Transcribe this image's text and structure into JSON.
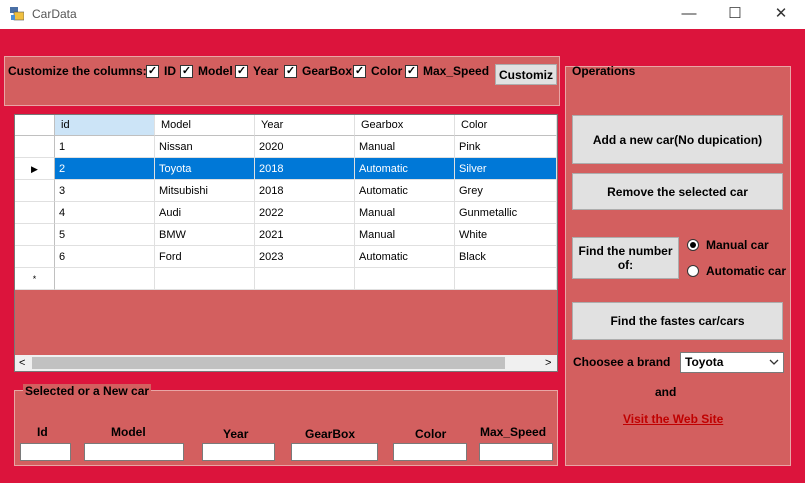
{
  "window": {
    "title": "CarData",
    "minimize": "—",
    "maximize": "☐",
    "close": "✕"
  },
  "customize": {
    "caption": "Customize the columns:",
    "checkboxes": [
      {
        "label": "ID",
        "checked": true
      },
      {
        "label": "Model",
        "checked": true
      },
      {
        "label": "Year",
        "checked": true
      },
      {
        "label": "GearBox",
        "checked": true
      },
      {
        "label": "Color",
        "checked": true
      },
      {
        "label": "Max_Speed",
        "checked": true
      }
    ],
    "button_label": "Customiz"
  },
  "grid": {
    "columns": [
      "id",
      "Model",
      "Year",
      "Gearbox",
      "Color"
    ],
    "rows": [
      [
        "1",
        "Nissan",
        "2020",
        "Manual",
        "Pink"
      ],
      [
        "2",
        "Toyota",
        "2018",
        "Automatic",
        "Silver"
      ],
      [
        "3",
        "Mitsubishi",
        "2018",
        "Automatic",
        "Grey"
      ],
      [
        "4",
        "Audi",
        "2022",
        "Manual",
        "Gunmetallic"
      ],
      [
        "5",
        "BMW",
        "2021",
        "Manual",
        "White"
      ],
      [
        "6",
        "Ford",
        "2023",
        "Automatic",
        "Black"
      ]
    ],
    "selected_row": 1,
    "new_row_marker": "*",
    "current_row_marker": "▶",
    "scroll_left": "<",
    "scroll_right": ">"
  },
  "car_form": {
    "caption": "Selected or a New car",
    "fields": [
      "Id",
      "Model",
      "Year",
      "GearBox",
      "Color",
      "Max_Speed"
    ]
  },
  "operations": {
    "caption": "Operations",
    "add_button": "Add a new car(No dupication)",
    "remove_button": "Remove the selected car",
    "find_number_button": "Find the number of:",
    "radio_manual": "Manual car",
    "radio_automatic": "Automatic car",
    "radio_selected": "Manual car",
    "fastest_button": "Find the fastes car/cars",
    "brand_label": "Choosee a brand",
    "brand_value": "Toyota",
    "and_label": "and",
    "web_link": "Visit the Web Site"
  }
}
